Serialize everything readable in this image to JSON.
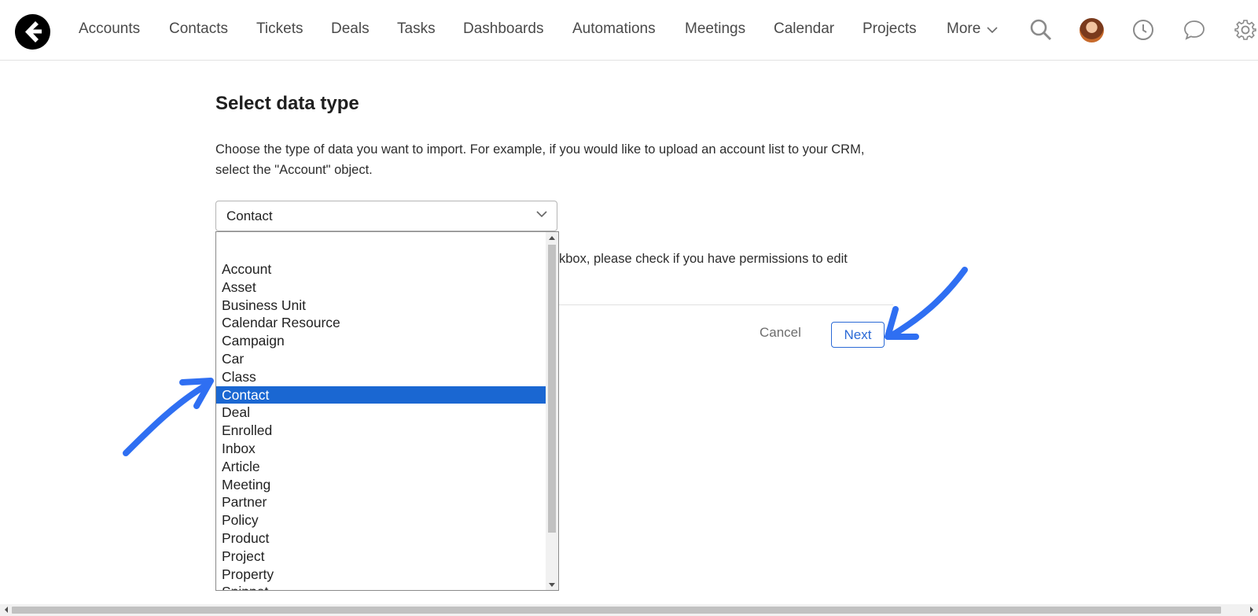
{
  "nav": {
    "items": [
      "Accounts",
      "Contacts",
      "Tickets",
      "Deals",
      "Tasks",
      "Dashboards",
      "Automations",
      "Meetings",
      "Calendar",
      "Projects"
    ],
    "more_label": "More"
  },
  "page": {
    "title": "Select data type",
    "description": "Choose the type of data you want to import. For example, if you would like to upload an account list to your CRM, select the \"Account\" object.",
    "partial_text": "kbox, please check if you have permissions to edit"
  },
  "select": {
    "value": "Contact",
    "options": [
      "",
      "Account",
      "Asset",
      "Business Unit",
      "Calendar Resource",
      "Campaign",
      "Car",
      "Class",
      "Contact",
      "Deal",
      "Enrolled",
      "Inbox",
      "Article",
      "Meeting",
      "Partner",
      "Policy",
      "Product",
      "Project",
      "Property",
      "Snippet"
    ],
    "selected_index": 8
  },
  "buttons": {
    "cancel": "Cancel",
    "next": "Next"
  },
  "colors": {
    "accent": "#2b6ad6",
    "selected_bg": "#1a67d2",
    "annotation_arrow": "#2f6ff2"
  },
  "icons": {
    "logo": "brand-logo-icon",
    "search": "search-icon",
    "history": "clock-icon",
    "chat": "chat-bubble-icon",
    "settings": "gear-icon"
  }
}
